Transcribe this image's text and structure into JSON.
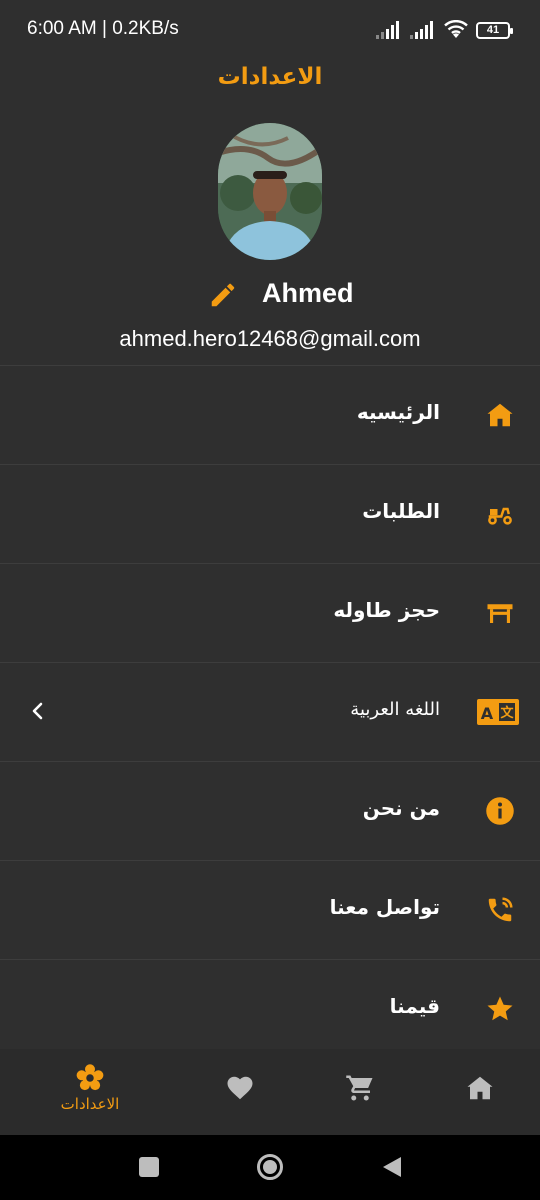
{
  "status_bar": {
    "time_speed": "6:00 AM | 0.2KB/s",
    "battery": "41"
  },
  "header": {
    "title": "الاعدادات"
  },
  "profile": {
    "name": "Ahmed",
    "email": "ahmed.hero12468@gmail.com"
  },
  "menu": [
    {
      "label": "الرئيسيه",
      "icon": "home-icon"
    },
    {
      "label": "الطلبات",
      "icon": "scooter-icon"
    },
    {
      "label": "حجز طاوله",
      "icon": "table-icon"
    },
    {
      "label": "اللغه العربية",
      "icon": "translate-icon",
      "has_chevron": true
    },
    {
      "label": "من نحن",
      "icon": "info-icon"
    },
    {
      "label": "تواصل معنا",
      "icon": "phone-call-icon"
    },
    {
      "label": "قيمنا",
      "icon": "star-icon"
    }
  ],
  "bottom_nav": {
    "settings_label": "الاعدادات",
    "items": [
      "settings-icon",
      "heart-icon",
      "cart-icon",
      "home-icon"
    ]
  },
  "colors": {
    "accent": "#f39c12",
    "background": "#2f2f2f",
    "divider": "#3d3d3d",
    "inactive": "#bdbdbd"
  }
}
